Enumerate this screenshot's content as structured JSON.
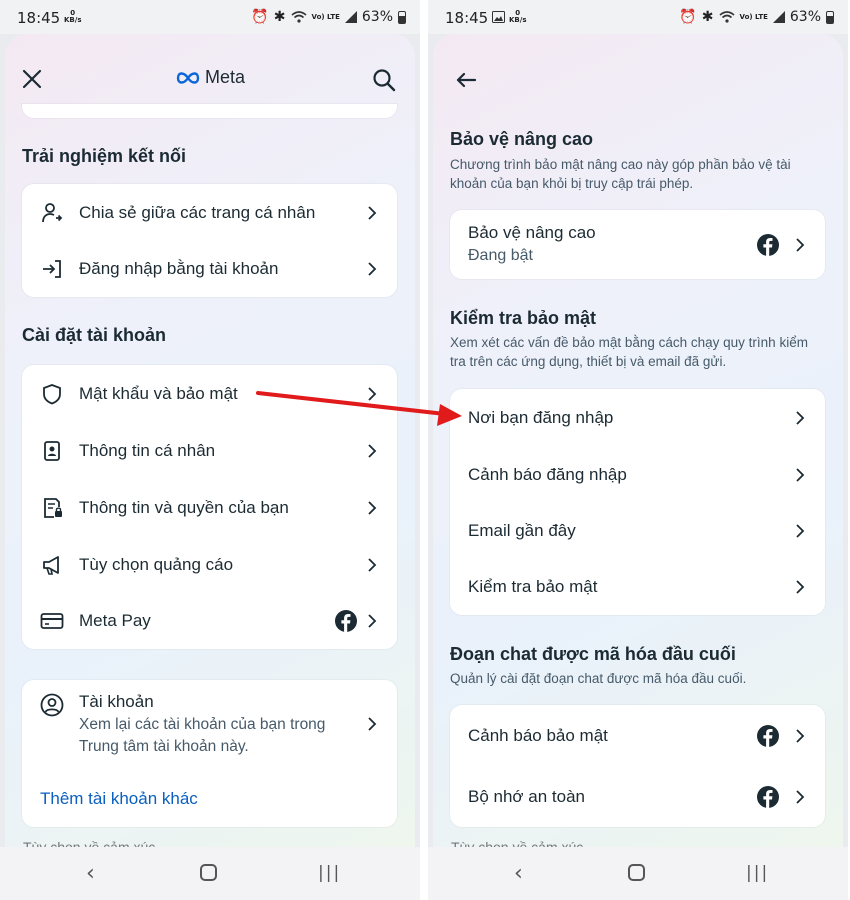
{
  "status": {
    "time": "18:45",
    "kbs": "KB/s",
    "kbs_value": "0",
    "battery": "63%",
    "lte": "Vo) LTE"
  },
  "left": {
    "brand": "Meta",
    "section1_title": "Trải nghiệm kết nối",
    "section1_items": [
      {
        "label": "Chia sẻ giữa các trang cá nhân",
        "icon": "share-profile-icon"
      },
      {
        "label": "Đăng nhập bằng tài khoản",
        "icon": "login-arrow-icon"
      }
    ],
    "section2_title": "Cài đặt tài khoản",
    "section2_items": [
      {
        "label": "Mật khẩu và bảo mật",
        "icon": "shield-icon"
      },
      {
        "label": "Thông tin cá nhân",
        "icon": "id-card-icon"
      },
      {
        "label": "Thông tin và quyền của bạn",
        "icon": "document-lock-icon"
      },
      {
        "label": "Tùy chọn quảng cáo",
        "icon": "megaphone-icon"
      },
      {
        "label": "Meta Pay",
        "icon": "credit-card-icon"
      }
    ],
    "accounts_title": "Tài khoản",
    "accounts_desc": "Xem lại các tài khoản của bạn trong Trung tâm tài khoản này.",
    "add_account": "Thêm tài khoản khác",
    "peek_text": "Tùy chọn về cảm xúc"
  },
  "right": {
    "advanced_title": "Bảo vệ nâng cao",
    "advanced_desc": "Chương trình bảo mật nâng cao này góp phần bảo vệ tài khoản của bạn khỏi bị truy cập trái phép.",
    "advanced_item_label": "Bảo vệ nâng cao",
    "advanced_item_status": "Đang bật",
    "check_title": "Kiểm tra bảo mật",
    "check_desc": "Xem xét các vấn đề bảo mật bằng cách chạy quy trình kiểm tra trên các ứng dụng, thiết bị và email đã gửi.",
    "check_items": [
      {
        "label": "Nơi bạn đăng nhập"
      },
      {
        "label": "Cảnh báo đăng nhập"
      },
      {
        "label": "Email gần đây"
      },
      {
        "label": "Kiểm tra bảo mật"
      }
    ],
    "e2e_title": "Đoạn chat được mã hóa đầu cuối",
    "e2e_desc": "Quản lý cài đặt đoạn chat được mã hóa đầu cuối.",
    "e2e_items": [
      {
        "label": "Cảnh báo bảo mật"
      },
      {
        "label": "Bộ nhớ an toàn"
      }
    ],
    "peek_text": "Tùy chọn về cảm xúc"
  },
  "colors": {
    "arrow": "#e11b1b",
    "link": "#0a5fc0",
    "facebook": "#1c2b33"
  }
}
